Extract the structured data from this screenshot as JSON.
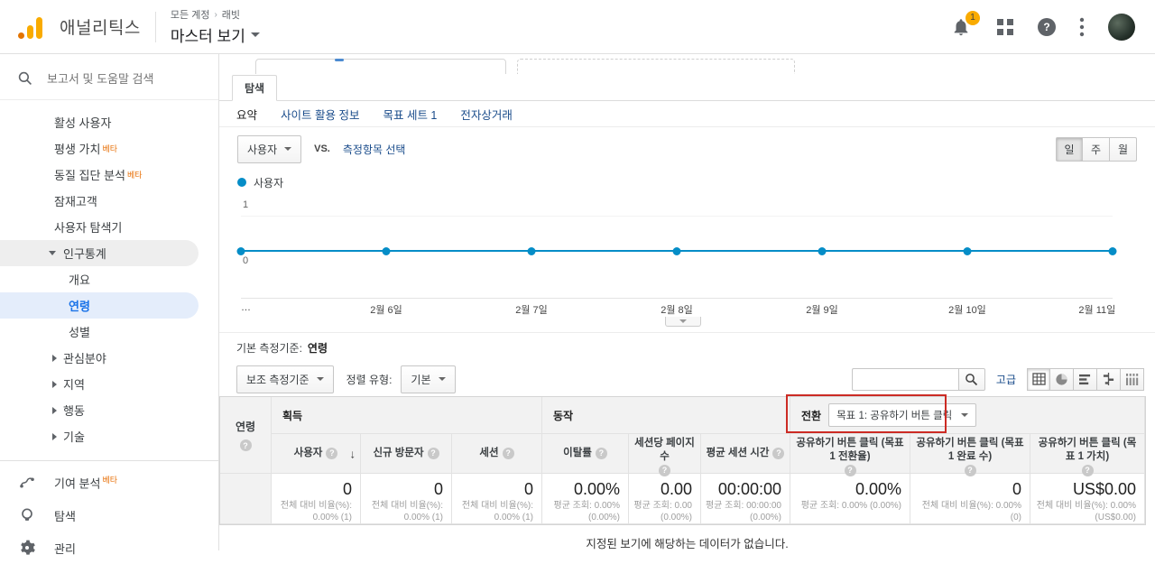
{
  "header": {
    "app_title": "애널리틱스",
    "breadcrumb": {
      "account": "모든 계정",
      "property": "래빗"
    },
    "view_name": "마스터 보기",
    "notification_count": "1"
  },
  "icons": {
    "help_glyph": "?"
  },
  "sidebar": {
    "search_placeholder": "보고서 및 도움말 검색",
    "items": [
      {
        "label": "활성 사용자"
      },
      {
        "label": "평생 가치",
        "beta": "베타"
      },
      {
        "label": "동질 집단 분석",
        "beta": "베타"
      },
      {
        "label": "잠재고객"
      },
      {
        "label": "사용자 탐색기"
      },
      {
        "label": "인구통계"
      },
      {
        "label": "개요"
      },
      {
        "label": "연령"
      },
      {
        "label": "성별"
      },
      {
        "label": "관심분야"
      },
      {
        "label": "지역"
      },
      {
        "label": "행동"
      },
      {
        "label": "기술"
      }
    ],
    "footer_items": [
      {
        "label": "기여 분석",
        "beta": "베타"
      },
      {
        "label": "탐색"
      },
      {
        "label": "관리"
      }
    ]
  },
  "tabs": {
    "active": "탐색"
  },
  "subnav": {
    "items": [
      "요약",
      "사이트 활용 정보",
      "목표 세트 1",
      "전자상거래"
    ]
  },
  "chart_controls": {
    "metric_dropdown": "사용자",
    "vs_label": "VS.",
    "select_metric_link": "측정항목 선택",
    "legend_label": "사용자",
    "granularity": [
      "일",
      "주",
      "월"
    ]
  },
  "chart_data": {
    "type": "line",
    "title": "사용자",
    "x": [
      "…",
      "2월 6일",
      "2월 7일",
      "2월 8일",
      "2월 9일",
      "2월 10일",
      "2월 11일"
    ],
    "series": [
      {
        "name": "사용자",
        "values": [
          0,
          0,
          0,
          0,
          0,
          0,
          0
        ]
      }
    ],
    "ylim": [
      0,
      1
    ],
    "y_labels": [
      "1",
      "0"
    ],
    "line_color": "#058dc7",
    "legend_position": "top-left",
    "grid": false
  },
  "table_controls": {
    "primary_dim_label": "기본 측정기준:",
    "primary_dim_value": "연령",
    "secondary_dim_button": "보조 측정기준",
    "sort_label": "정렬 유형:",
    "sort_value": "기본",
    "search_value": "",
    "advanced_link": "고급"
  },
  "table": {
    "row_dim": "연령",
    "groups": [
      "획득",
      "동작",
      "전환"
    ],
    "conversion_goal_dropdown": "목표 1: 공유하기 버튼 클릭",
    "columns": [
      {
        "label": "사용자"
      },
      {
        "label": "신규 방문자"
      },
      {
        "label": "세션"
      },
      {
        "label": "이탈률"
      },
      {
        "label": "세션당 페이지수"
      },
      {
        "label": "평균 세션 시간"
      },
      {
        "label": "공유하기 버튼 클릭 (목표 1 전환율)"
      },
      {
        "label": "공유하기 버튼 클릭 (목표 1 완료 수)"
      },
      {
        "label": "공유하기 버튼 클릭 (목표 1 가치)"
      }
    ],
    "totals": [
      {
        "value": "0",
        "sub": "전체 대비 비율(%): 0.00% (1)"
      },
      {
        "value": "0",
        "sub": "전체 대비 비율(%): 0.00% (1)"
      },
      {
        "value": "0",
        "sub": "전체 대비 비율(%): 0.00% (1)"
      },
      {
        "value": "0.00%",
        "sub": "평균 조회: 0.00% (0.00%)"
      },
      {
        "value": "0.00",
        "sub": "평균 조회: 0.00 (0.00%)"
      },
      {
        "value": "00:00:00",
        "sub": "평균 조회: 00:00:00 (0.00%)"
      },
      {
        "value": "0.00%",
        "sub": "평균 조회: 0.00% (0.00%)"
      },
      {
        "value": "0",
        "sub": "전체 대비 비율(%): 0.00% (0)"
      },
      {
        "value": "US$0.00",
        "sub": "전체 대비 비율(%): 0.00% (US$0.00)"
      }
    ],
    "empty_message": "지정된 보기에 해당하는 데이터가 없습니다."
  }
}
